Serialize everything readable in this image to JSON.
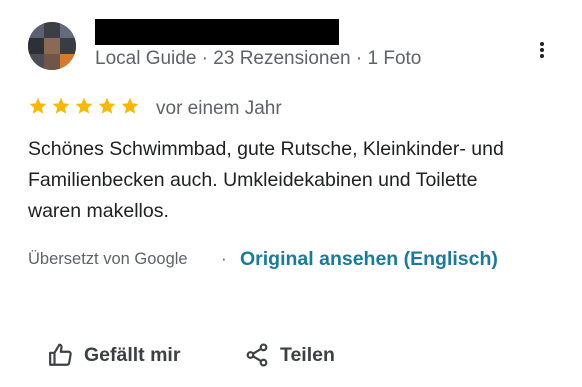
{
  "reviewer": {
    "meta": "Local Guide · 23 Rezensionen · 1 Foto"
  },
  "review": {
    "rating": 5,
    "max_rating": 5,
    "date": "vor einem Jahr",
    "text_lines": [
      "Schönes Schwimmbad, gute Rutsche, Kleinkinder- und",
      "Familienbecken auch. Umkleidekabinen und Toilette",
      "waren makellos."
    ]
  },
  "translation": {
    "translated_by": "Übersetzt von Google",
    "separator": "·",
    "original_link": "Original ansehen (Englisch)"
  },
  "actions": {
    "like_label": "Gefällt mir",
    "share_label": "Teilen"
  },
  "colors": {
    "star": "#f9b700",
    "link": "#1a7a9e",
    "meta_text": "#5f6368",
    "body_text": "#202124"
  },
  "icons": {
    "more": "more-vert-icon",
    "star": "star-icon",
    "like": "thumb-up-icon",
    "share": "share-icon"
  }
}
